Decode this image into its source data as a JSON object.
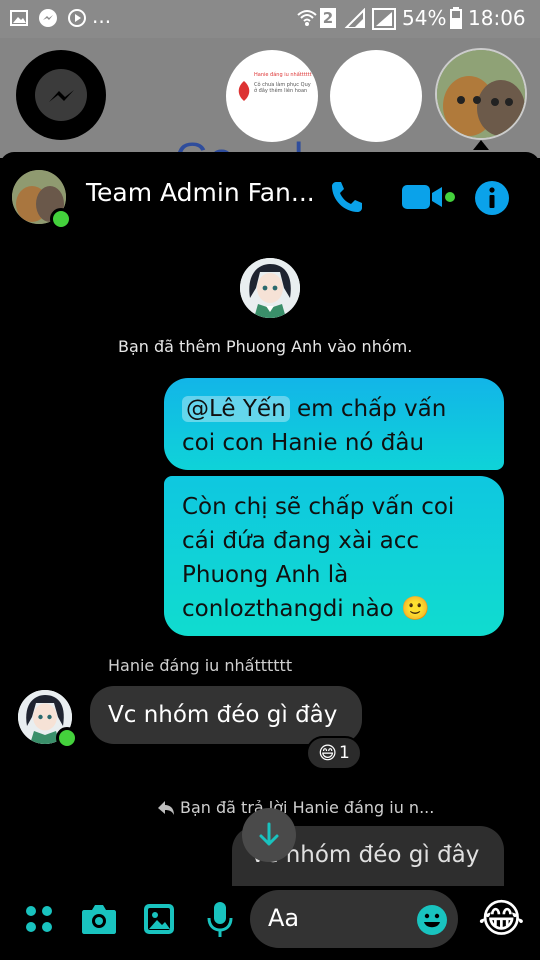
{
  "status_bar": {
    "battery": "54%",
    "time": "18:06",
    "sim_badge": "2",
    "more": "..."
  },
  "chat_heads": {
    "preview_card_title": "Hanie đáng iu nhấtttttt",
    "preview_card_subtitle": "Cô chưa làm phục Quy ở đây thêm liên hoan",
    "background_text": "Gooole"
  },
  "header": {
    "title": "Team Admin Fan...",
    "online": true
  },
  "messages": {
    "system_added": "Bạn đã thêm Phuong Anh vào nhóm.",
    "me_1_mention": "@Lê Yến",
    "me_1_rest_line1": " em chấp vấn",
    "me_1_line2": "coi con Hanie nó đâu",
    "me_2_lines": [
      "Còn chị sẽ chấp vấn coi",
      "cái đứa đang xài acc",
      "Phuong Anh là",
      "conlozthangdi nào 🙂"
    ],
    "other_sender": "Hanie đáng iu nhấtttttt",
    "other_text": "Vc nhóm đéo gì đây",
    "reaction_emoji": "😄",
    "reaction_count": "1",
    "reply_header": "Bạn đã trả lời Hanie đáng iu n...",
    "reply_quote": "Vc nhóm đéo gì đây"
  },
  "composer": {
    "placeholder": "Aa",
    "quick_reaction": "😂"
  },
  "colors": {
    "accent": "#0aa2ea",
    "bubble_me_top": "#12b5e8",
    "bubble_me_bottom": "#0fd3d8",
    "teal_icon": "#19c3bf",
    "online": "#44d13c"
  }
}
